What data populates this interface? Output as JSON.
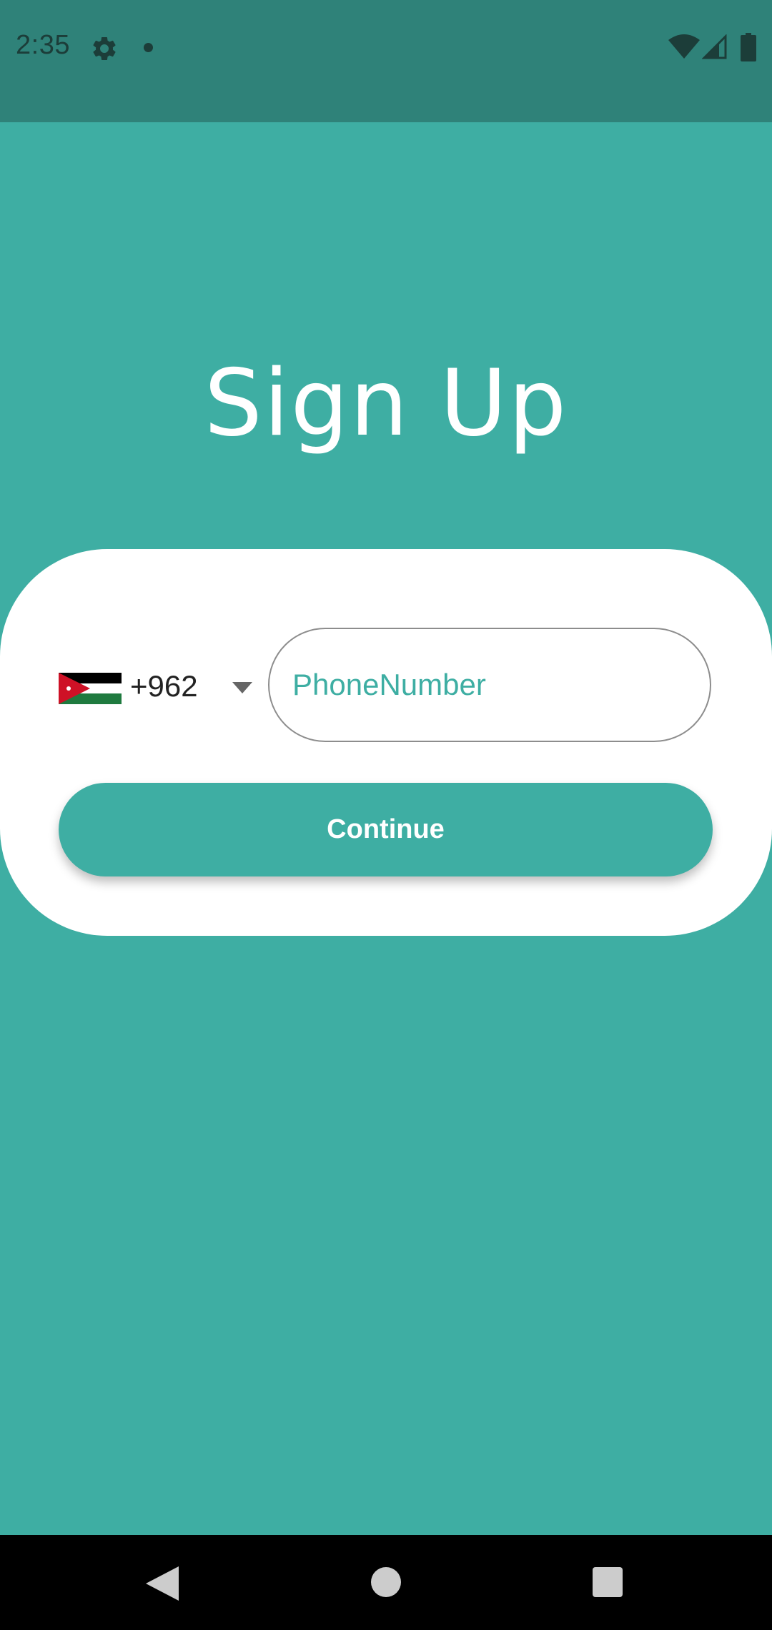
{
  "status_bar": {
    "time": "2:35",
    "icons": [
      "gear-icon",
      "notification-dot-icon",
      "wifi-icon",
      "signal-icon",
      "battery-icon"
    ]
  },
  "header": {
    "title": "Sign Up"
  },
  "form": {
    "country": {
      "flag": "jordan-flag-icon",
      "code": "+962"
    },
    "phone": {
      "placeholder": "PhoneNumber",
      "value": ""
    },
    "continue_label": "Continue"
  },
  "nav_bar": {
    "icons": [
      "back-icon",
      "home-icon",
      "recents-icon"
    ]
  },
  "colors": {
    "primary": "#3eaea3",
    "status_bar": "#2f8279",
    "card": "#ffffff",
    "nav_bar": "#000000"
  }
}
